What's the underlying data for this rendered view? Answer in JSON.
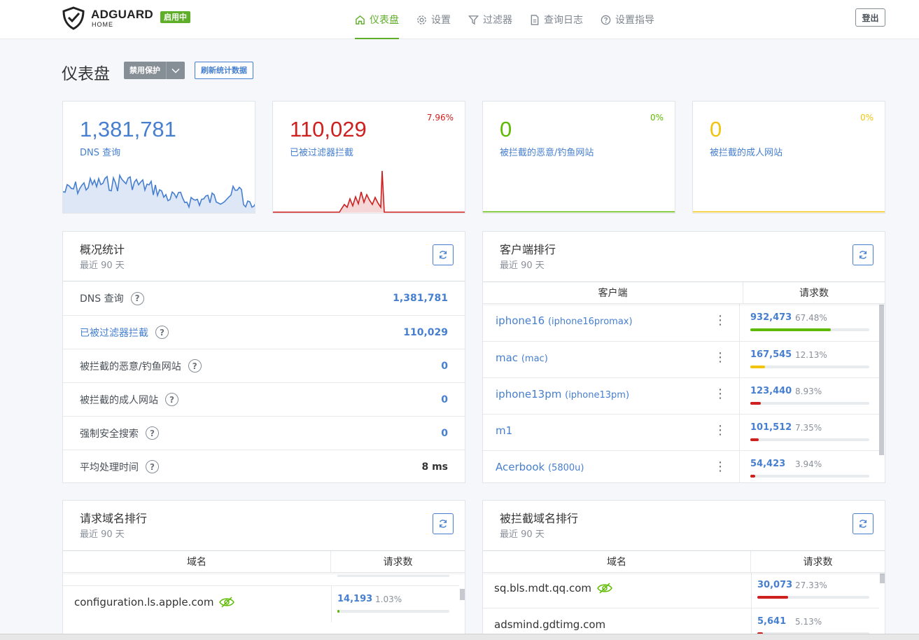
{
  "header": {
    "logo_name": "ADGUARD",
    "logo_sub": "HOME",
    "status_badge": "启用中",
    "nav": [
      {
        "label": "仪表盘",
        "icon": "home-icon",
        "active": true
      },
      {
        "label": "设置",
        "icon": "gear-icon"
      },
      {
        "label": "过滤器",
        "icon": "filter-icon"
      },
      {
        "label": "查询日志",
        "icon": "document-icon"
      },
      {
        "label": "设置指导",
        "icon": "question-icon"
      }
    ],
    "logout": "登出"
  },
  "page": {
    "title": "仪表盘",
    "disable_btn": "禁用保护",
    "refresh_btn": "刷新统计数据"
  },
  "cards": [
    {
      "value": "1,381,781",
      "label": "DNS 查询",
      "percent": "",
      "color": "#467fcf"
    },
    {
      "value": "110,029",
      "label": "已被过滤器拦截",
      "percent": "7.96%",
      "color": "#cd201f"
    },
    {
      "value": "0",
      "label": "被拦截的恶意/钓鱼网站",
      "percent": "0%",
      "color": "#5eba00"
    },
    {
      "value": "0",
      "label": "被拦截的成人网站",
      "percent": "0%",
      "color": "#f1c40f"
    }
  ],
  "overview": {
    "title": "概况统计",
    "subtitle": "最近 90 天",
    "rows": [
      {
        "label": "DNS 查询",
        "value": "1,381,781",
        "link": false
      },
      {
        "label": "已被过滤器拦截",
        "value": "110,029",
        "link": true
      },
      {
        "label": "被拦截的恶意/钓鱼网站",
        "value": "0",
        "link": false
      },
      {
        "label": "被拦截的成人网站",
        "value": "0",
        "link": false
      },
      {
        "label": "强制安全搜索",
        "value": "0",
        "link": false
      },
      {
        "label": "平均处理时间",
        "value": "8 ms",
        "link": false,
        "dark": true
      }
    ]
  },
  "clients": {
    "title": "客户端排行",
    "subtitle": "最近 90 天",
    "col_client": "客户端",
    "col_requests": "请求数",
    "rows": [
      {
        "name": "iphone16",
        "alias": "(iphone16promax)",
        "count": "932,473",
        "percent": "67.48%",
        "fraction": 0.6748,
        "color": "#5eba00"
      },
      {
        "name": "mac",
        "alias": "(mac)",
        "count": "167,545",
        "percent": "12.13%",
        "fraction": 0.1213,
        "color": "#f1c40f"
      },
      {
        "name": "iphone13pm",
        "alias": "(iphone13pm)",
        "count": "123,440",
        "percent": "8.93%",
        "fraction": 0.0893,
        "color": "#cd201f"
      },
      {
        "name": "m1",
        "alias": "",
        "count": "101,512",
        "percent": "7.35%",
        "fraction": 0.0735,
        "color": "#cd201f"
      },
      {
        "name": "Acerbook",
        "alias": "(5800u)",
        "count": "54,423",
        "percent": "3.94%",
        "fraction": 0.0394,
        "color": "#cd201f"
      }
    ]
  },
  "queried": {
    "title": "请求域名排行",
    "subtitle": "最近 90 天",
    "col_domain": "域名",
    "col_requests": "请求数",
    "rows": [
      {
        "domain": "configuration.ls.apple.com",
        "count": "14,193",
        "percent": "1.03%",
        "fraction": 0.0103,
        "color": "#5eba00"
      }
    ]
  },
  "blocked": {
    "title": "被拦截域名排行",
    "subtitle": "最近 90 天",
    "col_domain": "域名",
    "col_requests": "请求数",
    "rows": [
      {
        "domain": "sq.bls.mdt.qq.com",
        "count": "30,073",
        "percent": "27.33%",
        "fraction": 0.2733,
        "color": "#cd201f",
        "eye": true
      },
      {
        "domain": "adsmind.gdtimg.com",
        "count": "5,641",
        "percent": "5.13%",
        "fraction": 0.0513,
        "color": "#cd201f",
        "eye": false
      }
    ]
  }
}
